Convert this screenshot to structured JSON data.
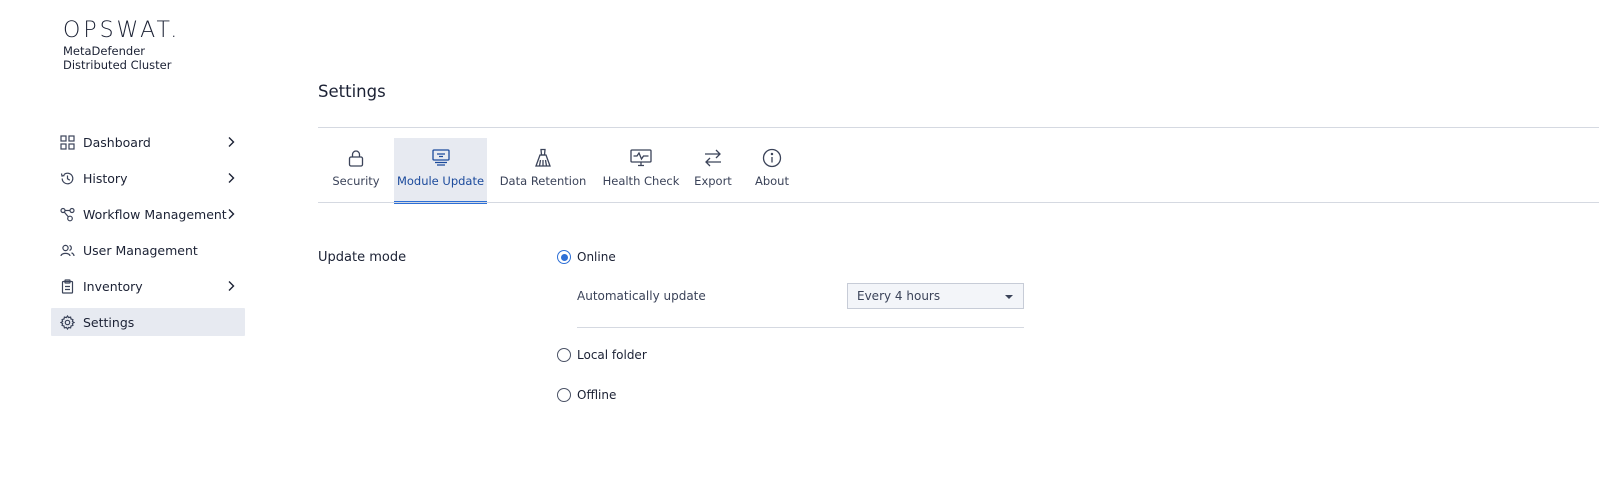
{
  "brand": {
    "logo": "OPSWAT.",
    "product_line1": "MetaDefender",
    "product_line2": "Distributed Cluster"
  },
  "sidebar": {
    "items": [
      {
        "label": "Dashboard",
        "icon": "grid-icon",
        "has_chevron": true
      },
      {
        "label": "History",
        "icon": "history-icon",
        "has_chevron": true
      },
      {
        "label": "Workflow Management",
        "icon": "workflow-icon",
        "has_chevron": true
      },
      {
        "label": "User Management",
        "icon": "users-icon",
        "has_chevron": false
      },
      {
        "label": "Inventory",
        "icon": "clipboard-icon",
        "has_chevron": true
      },
      {
        "label": "Settings",
        "icon": "gear-icon",
        "has_chevron": false,
        "active": true
      }
    ]
  },
  "page": {
    "title": "Settings"
  },
  "tabs": [
    {
      "label": "Security",
      "icon": "lock-icon"
    },
    {
      "label": "Module Update",
      "icon": "monitor-update-icon",
      "active": true
    },
    {
      "label": "Data Retention",
      "icon": "broom-icon"
    },
    {
      "label": "Health Check",
      "icon": "health-monitor-icon"
    },
    {
      "label": "Export",
      "icon": "swap-arrows-icon"
    },
    {
      "label": "About",
      "icon": "info-icon"
    }
  ],
  "update_mode": {
    "label": "Update mode",
    "options": [
      {
        "label": "Online",
        "checked": true
      },
      {
        "label": "Local folder",
        "checked": false
      },
      {
        "label": "Offline",
        "checked": false
      }
    ],
    "auto_update_label": "Automatically update",
    "auto_update_value": "Every 4 hours"
  },
  "colors": {
    "accent": "#2d6fd6",
    "active_bg": "#e7eaf1",
    "text": "#1b2134"
  }
}
